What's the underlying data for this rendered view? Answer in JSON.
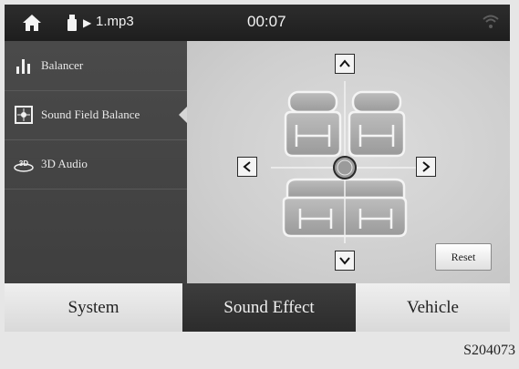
{
  "status_bar": {
    "track_name": "1.mp3",
    "elapsed_time": "00:07",
    "play_glyph": "▶"
  },
  "sidebar": {
    "items": [
      {
        "label": "Balancer",
        "icon": "equalizer-bars-icon",
        "selected": false
      },
      {
        "label": "Sound Field Balance",
        "icon": "sound-field-icon",
        "selected": true
      },
      {
        "label": "3D Audio",
        "icon": "3d-audio-icon",
        "selected": false
      }
    ]
  },
  "stage": {
    "reset_label": "Reset"
  },
  "tabs": [
    {
      "label": "System",
      "active": false
    },
    {
      "label": "Sound Effect",
      "active": true
    },
    {
      "label": "Vehicle",
      "active": false
    }
  ],
  "figure_code": "S204073"
}
